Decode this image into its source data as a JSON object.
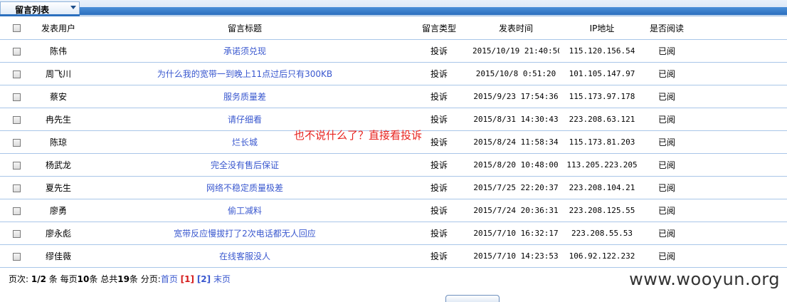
{
  "panel": {
    "tab_label": "留言列表"
  },
  "columns": {
    "user": "发表用户",
    "title": "留言标题",
    "type": "留言类型",
    "time": "发表时间",
    "ip": "IP地址",
    "read": "是否阅读"
  },
  "rows": [
    {
      "user": "陈伟",
      "title": "承诺须兑现",
      "type": "投诉",
      "time": "2015/10/19 21:40:50",
      "ip": "115.120.156.54",
      "read": "已阅"
    },
    {
      "user": "周飞川",
      "title": "为什么我的宽带一到晚上11点过后只有300KB",
      "type": "投诉",
      "time": "2015/10/8 0:51:20",
      "ip": "101.105.147.97",
      "read": "已阅"
    },
    {
      "user": "蔡安",
      "title": "服务质量差",
      "type": "投诉",
      "time": "2015/9/23 17:54:36",
      "ip": "115.173.97.178",
      "read": "已阅"
    },
    {
      "user": "冉先生",
      "title": "请仔细看",
      "type": "投诉",
      "time": "2015/8/31 14:30:43",
      "ip": "223.208.63.121",
      "read": "已阅"
    },
    {
      "user": "陈琼",
      "title": "烂长城",
      "type": "投诉",
      "time": "2015/8/24 11:58:34",
      "ip": "115.173.81.203",
      "read": "已阅"
    },
    {
      "user": "杨武龙",
      "title": "完全没有售后保证",
      "type": "投诉",
      "time": "2015/8/20 10:48:00",
      "ip": "113.205.223.205",
      "read": "已阅"
    },
    {
      "user": "夏先生",
      "title": "网络不稳定质量极差",
      "type": "投诉",
      "time": "2015/7/25 22:20:37",
      "ip": "223.208.104.21",
      "read": "已阅"
    },
    {
      "user": "廖勇",
      "title": "偷工减料",
      "type": "投诉",
      "time": "2015/7/24 20:36:31",
      "ip": "223.208.125.55",
      "read": "已阅"
    },
    {
      "user": "廖永彪",
      "title": "宽带反应慢拔打了2次电话都无人回应",
      "type": "投诉",
      "time": "2015/7/10 16:32:17",
      "ip": "223.208.55.53",
      "read": "已阅"
    },
    {
      "user": "缪佳薇",
      "title": "在线客服没人",
      "type": "投诉",
      "time": "2015/7/10 14:23:53",
      "ip": "106.92.122.232",
      "read": "已阅"
    }
  ],
  "annotation": "也不说什么了？直接看投诉",
  "pager": {
    "pages_label": "页次:",
    "pages_value": "1/2",
    "pages_unit": "条",
    "per_page_label": "每页",
    "per_page_value": "10",
    "per_page_unit": "条",
    "total_label": "总共",
    "total_value": "19",
    "total_unit": "条",
    "paging_label": "分页:",
    "first": "首页",
    "page1": "[1]",
    "page2": "[2]",
    "last": "末页"
  },
  "watermark": "www.wooyun.org",
  "colors": {
    "link": "#3a58cf",
    "annotation": "#e8241f",
    "current_page": "#d51c1c",
    "header_bar": "#2b6fbe",
    "row_border": "#a9c6e8"
  }
}
